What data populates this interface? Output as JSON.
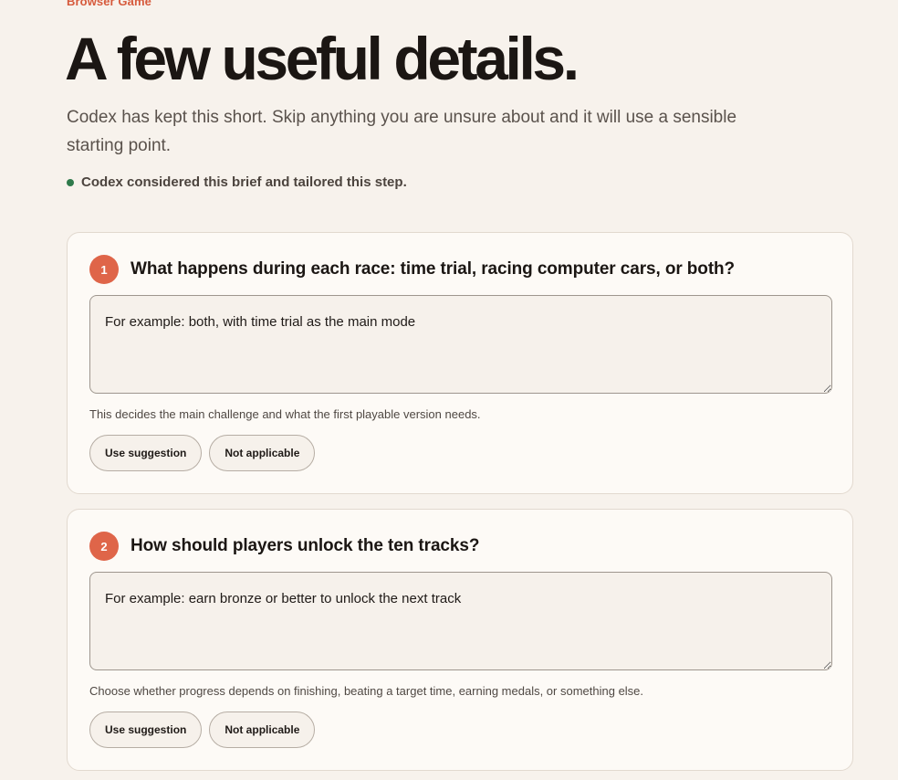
{
  "header": {
    "eyebrow": "Browser Game",
    "title": "A few useful details.",
    "lead": "Codex has kept this short. Skip anything you are unsure about and it will use a sensible starting point.",
    "status_text": "Codex considered this brief and tailored this step.",
    "status_color": "#2f7a4b"
  },
  "accent_color": "#df6549",
  "questions": [
    {
      "number": "1",
      "text": "What happens during each race: time trial, racing computer cars, or both?",
      "placeholder": "For example: both, with time trial as the main mode",
      "value": "",
      "hint": "This decides the main challenge and what the first playable version needs.",
      "suggestion_label": "Use suggestion",
      "na_label": "Not applicable"
    },
    {
      "number": "2",
      "text": "How should players unlock the ten tracks?",
      "placeholder": "For example: earn bronze or better to unlock the next track",
      "value": "",
      "hint": "Choose whether progress depends on finishing, beating a target time, earning medals, or something else.",
      "suggestion_label": "Use suggestion",
      "na_label": "Not applicable"
    }
  ]
}
